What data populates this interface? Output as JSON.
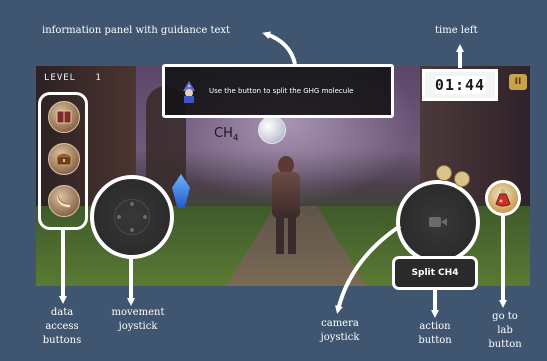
{
  "hud": {
    "level_label": "LEVEL",
    "level_value": "1",
    "timer": "01:44",
    "pause_glyph": "II"
  },
  "info_panel": {
    "text": "Use the button to split the GHG molecule",
    "icon": "wizard-icon"
  },
  "scene": {
    "molecule_label": "CH",
    "molecule_subscript": "4"
  },
  "controls": {
    "action_label": "Split CH4",
    "data_buttons": [
      "book-icon",
      "chest-icon",
      "horn-icon"
    ],
    "lab_button_icon": "potion-icon"
  },
  "annotations": {
    "info": "information panel with guidance text",
    "time": "time left",
    "data_line1": "data",
    "data_line2": "access",
    "data_line3": "buttons",
    "move_line1": "movement",
    "move_line2": "joystick",
    "cam_line1": "camera",
    "cam_line2": "joystick",
    "action_line1": "action",
    "action_line2": "button",
    "lab_line1": "go to",
    "lab_line2": "lab",
    "lab_line3": "button"
  },
  "colors": {
    "background": "#3f5570",
    "annotation": "#ffffff",
    "timer_bg": "#ffffff"
  }
}
